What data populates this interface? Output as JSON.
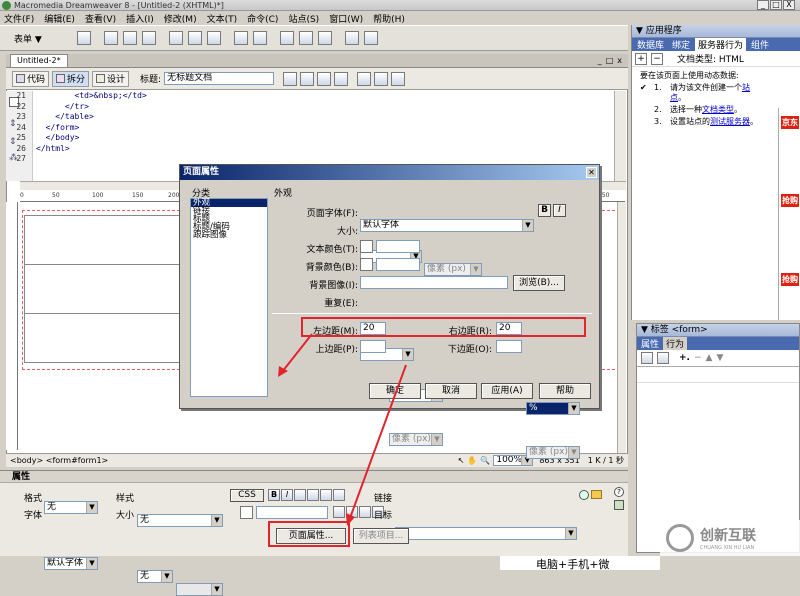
{
  "app": {
    "title": "Macromedia Dreamweaver 8 - [Untitled-2 (XHTML)*]",
    "min": "_",
    "max": "□",
    "close": "X"
  },
  "menu": [
    "文件(F)",
    "编辑(E)",
    "查看(V)",
    "插入(I)",
    "修改(M)",
    "文本(T)",
    "命令(C)",
    "站点(S)",
    "窗口(W)",
    "帮助(H)"
  ],
  "insertbar": {
    "category": "表单 ▼"
  },
  "doc": {
    "tab": "Untitled-2*",
    "view_code": "代码",
    "view_split": "拆分",
    "view_design": "设计",
    "title_label": "标题:",
    "title_value": "无标题文档",
    "win_min": "_",
    "win_max": "□",
    "win_close": "x"
  },
  "code": {
    "lines": [
      {
        "n": "21",
        "t": "        <td>&nbsp;</td>"
      },
      {
        "n": "22",
        "t": "      </tr>"
      },
      {
        "n": "23",
        "t": "    </table>"
      },
      {
        "n": "24",
        "t": "  </form>"
      },
      {
        "n": "25",
        "t": "  </body>"
      },
      {
        "n": "26",
        "t": "</html>"
      },
      {
        "n": "27",
        "t": ""
      }
    ]
  },
  "ruler": {
    "ticks": [
      "0",
      "50",
      "100",
      "150",
      "200",
      "850"
    ]
  },
  "status": {
    "path": "<body> <form#form1>",
    "zoom": "100%",
    "size": "863 x 351",
    "weight": "1 K / 1 秒"
  },
  "props": {
    "title": "属性",
    "format_label": "格式",
    "format_value": "无",
    "style_label": "样式",
    "style_value": "无",
    "css": "CSS",
    "font_label": "字体",
    "font_value": "默认字体",
    "size_label": "大小",
    "size_value": "无",
    "link_label": "链接",
    "target_label": "目标",
    "page_props_button": "页面属性...",
    "list_item_button": "列表项目..."
  },
  "rpanel": {
    "title": "应用程序",
    "tabs": [
      "数据库",
      "绑定",
      "服务器行为",
      "组件"
    ],
    "doctype": "文档类型: HTML",
    "intro": "要在该页面上使用动态数据:",
    "steps": [
      {
        "n": "1.",
        "pre": "请为该文件创建一个",
        "link": "站点",
        "post": "。"
      },
      {
        "n": "2.",
        "pre": "选择一种",
        "link": "文档类型",
        "post": "。"
      },
      {
        "n": "3.",
        "pre": "设置站点的",
        "link": "测试服务器",
        "post": "。"
      }
    ]
  },
  "tagpanel": {
    "title": "标签 <form>",
    "tab1": "属性",
    "tab2": "行为"
  },
  "dialog": {
    "title": "页面属性",
    "category_header": "分类",
    "categories": [
      "外观",
      "链接",
      "标题",
      "标题/编码",
      "跟踪图像"
    ],
    "section_header": "外观",
    "font_label": "页面字体(F):",
    "font_value": "默认字体",
    "bold": "B",
    "italic": "I",
    "size_label": "大小:",
    "unit_px": "像素 (px)",
    "text_color_label": "文本颜色(T):",
    "bg_color_label": "背景颜色(B):",
    "bg_image_label": "背景图像(I):",
    "browse": "浏览(B)...",
    "repeat_label": "重复(E):",
    "left_margin_label": "左边距(M):",
    "left_margin_value": "20",
    "left_unit": "%",
    "right_margin_label": "右边距(R):",
    "right_margin_value": "20",
    "right_unit": "%",
    "top_margin_label": "上边距(P):",
    "bottom_margin_label": "下边距(O):",
    "ok": "确定",
    "cancel": "取消",
    "apply": "应用(A)",
    "help": "帮助"
  },
  "side_ads": [
    "京东",
    "抢购",
    "抢购"
  ],
  "watermark": {
    "cn": "创新互联",
    "en": "CHUANG XIN HU LIAN"
  },
  "footer_text": "电脑+手机+微",
  "colors": {
    "accent_red": "#e0262c",
    "dialog_title": "#0a246a",
    "panel_head": "#a7b9d8"
  }
}
